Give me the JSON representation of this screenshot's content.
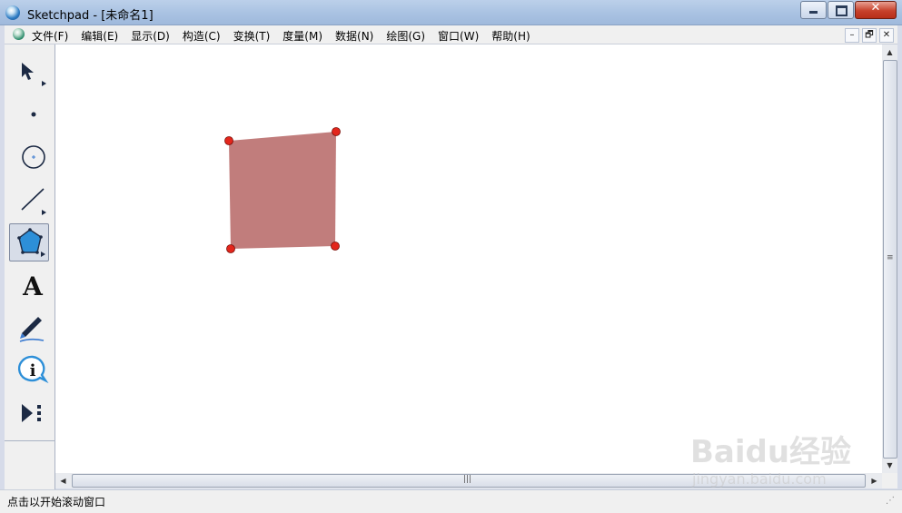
{
  "window": {
    "title": "Sketchpad  - [未命名1]",
    "buttons": {
      "minimize": "–",
      "maximize": "□",
      "close": "✕"
    }
  },
  "menubar": {
    "items": [
      {
        "label": "文件(F)"
      },
      {
        "label": "编辑(E)"
      },
      {
        "label": "显示(D)"
      },
      {
        "label": "构造(C)"
      },
      {
        "label": "变换(T)"
      },
      {
        "label": "度量(M)"
      },
      {
        "label": "数据(N)"
      },
      {
        "label": "绘图(G)"
      },
      {
        "label": "窗口(W)"
      },
      {
        "label": "帮助(H)"
      }
    ],
    "mdi_buttons": [
      "–",
      "🗗",
      "✕"
    ]
  },
  "toolbox": {
    "tools": [
      {
        "name": "arrow-select-tool",
        "icon": "arrow-icon",
        "has_submenu": true,
        "selected": false
      },
      {
        "name": "point-tool",
        "icon": "dot-icon",
        "has_submenu": false,
        "selected": false
      },
      {
        "name": "compass-tool",
        "icon": "circle-icon",
        "has_submenu": false,
        "selected": false
      },
      {
        "name": "straightedge-tool",
        "icon": "line-icon",
        "has_submenu": true,
        "selected": false
      },
      {
        "name": "polygon-tool",
        "icon": "pentagon-icon",
        "has_submenu": true,
        "selected": true
      },
      {
        "name": "text-tool",
        "icon": "letter-a-icon",
        "has_submenu": false,
        "selected": false,
        "glyph": "A"
      },
      {
        "name": "marker-tool",
        "icon": "marker-pen-icon",
        "has_submenu": false,
        "selected": false
      },
      {
        "name": "information-tool",
        "icon": "info-icon",
        "has_submenu": false,
        "selected": false,
        "glyph": "i"
      },
      {
        "name": "custom-tool",
        "icon": "play-custom-icon",
        "has_submenu": false,
        "selected": false
      }
    ]
  },
  "canvas": {
    "polygon": {
      "fill_color": "#c17d7c",
      "vertex_color": "#e3261c",
      "vertices": [
        {
          "label": "top-left"
        },
        {
          "label": "top-right"
        },
        {
          "label": "bottom-right"
        },
        {
          "label": "bottom-left"
        }
      ]
    }
  },
  "statusbar": {
    "text": "点击以开始滚动窗口"
  },
  "watermark": {
    "logo": "Baidu经验",
    "url": "jingyan.baidu.com"
  }
}
